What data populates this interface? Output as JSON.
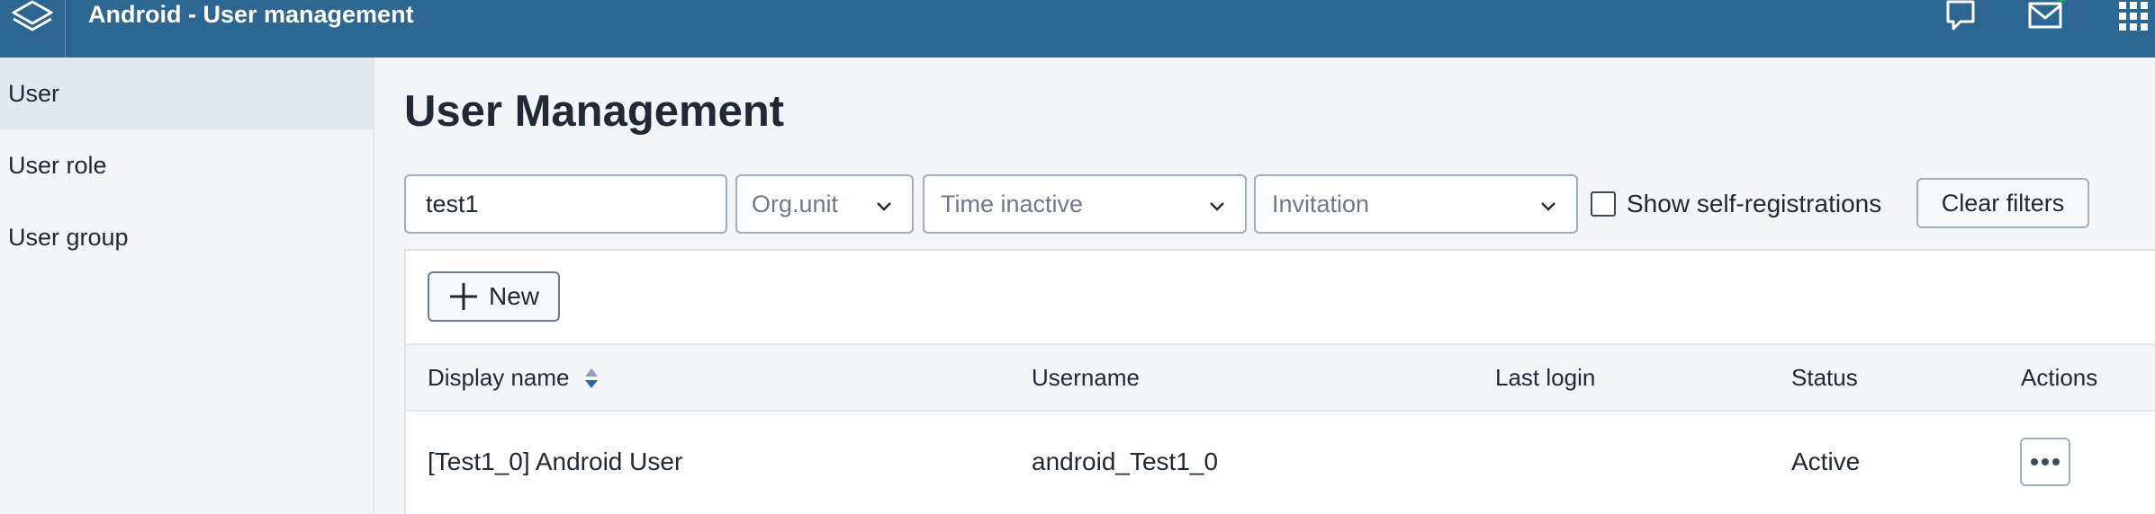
{
  "header": {
    "title": "Android - User management",
    "icons": [
      "layers-logo-icon",
      "chat-icon",
      "mail-icon",
      "apps-grid-icon"
    ],
    "accent_color": "#2c6693",
    "badge_color": "#22a06b"
  },
  "sidebar": {
    "items": [
      {
        "label": "User",
        "active": true
      },
      {
        "label": "User role",
        "active": false
      },
      {
        "label": "User group",
        "active": false
      }
    ]
  },
  "main": {
    "title": "User Management",
    "filters": {
      "search_value": "test1",
      "org_unit_placeholder": "Org.unit",
      "time_inactive_placeholder": "Time inactive",
      "invitation_placeholder": "Invitation",
      "show_self_registrations_label": "Show self-registrations",
      "show_self_registrations_checked": false,
      "clear_filters_label": "Clear filters"
    },
    "new_button_label": "New",
    "table": {
      "columns": [
        "Display name",
        "Username",
        "Last login",
        "Status",
        "Actions"
      ],
      "rows": [
        {
          "display_name": "[Test1_0] Android User",
          "username": "android_Test1_0",
          "last_login": "",
          "status": "Active"
        }
      ]
    }
  }
}
